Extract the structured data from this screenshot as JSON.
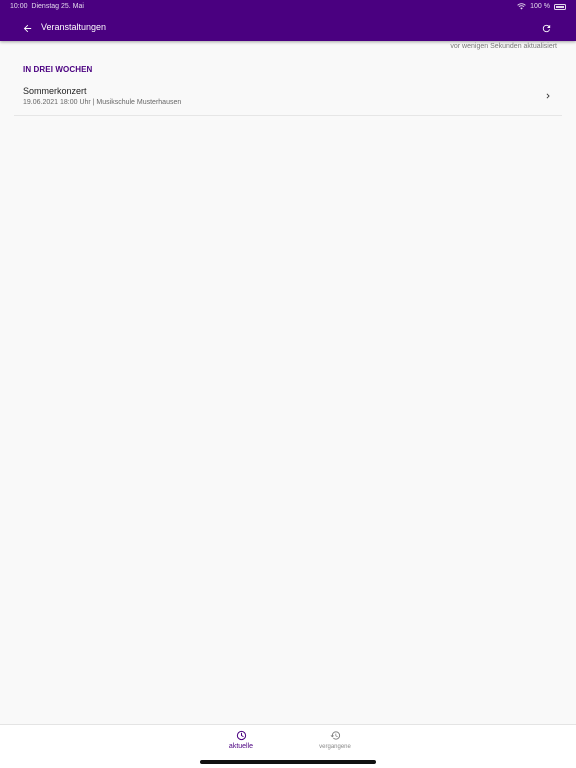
{
  "status_bar": {
    "time": "10:00",
    "date": "Dienstag 25. Mai",
    "battery": "100 %"
  },
  "header": {
    "title": "Veranstaltungen",
    "back_icon": "arrow-left-icon",
    "refresh_icon": "refresh-icon",
    "background_color": "#4a0080"
  },
  "updated_text": "vor wenigen Sekunden aktualisiert",
  "section": {
    "title": "IN DREI WOCHEN",
    "items": [
      {
        "title": "Sommerkonzert",
        "subtitle": "19.06.2021 18:00 Uhr | Musikschule Musterhausen"
      }
    ]
  },
  "bottom_nav": {
    "tabs": [
      {
        "label": "aktuelle",
        "icon": "clock-icon",
        "active": true
      },
      {
        "label": "vergangene",
        "icon": "history-icon",
        "active": false
      }
    ],
    "accent_color": "#4a0080"
  }
}
